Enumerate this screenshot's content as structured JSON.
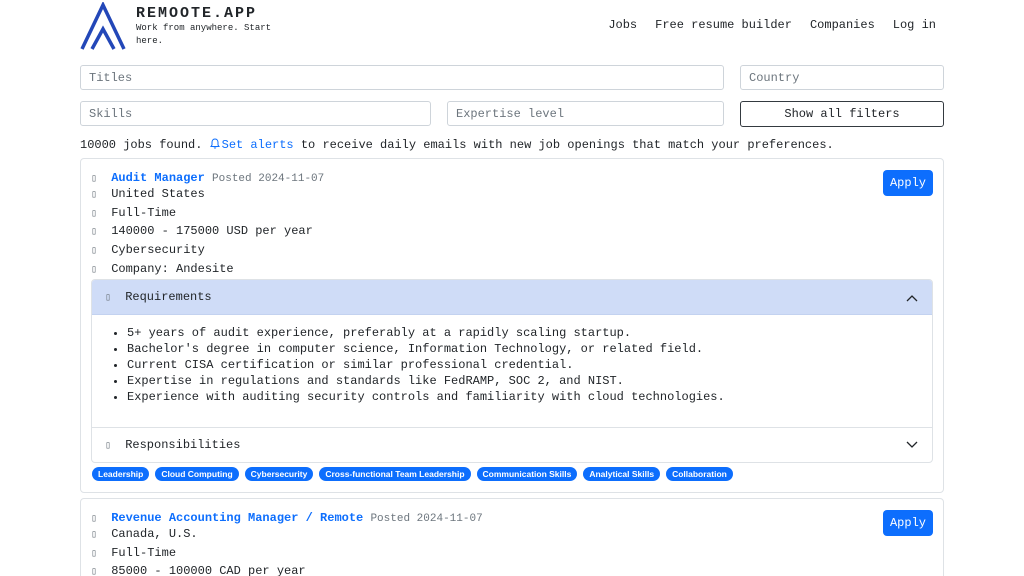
{
  "brand": {
    "name": "REMOOTE.APP",
    "tagline": "Work from anywhere. Start here."
  },
  "nav": {
    "jobs": "Jobs",
    "resume": "Free resume builder",
    "companies": "Companies",
    "login": "Log in"
  },
  "filters": {
    "titles_placeholder": "Titles",
    "country_placeholder": "Country",
    "skills_placeholder": "Skills",
    "expertise_placeholder": "Expertise level",
    "show_all": "Show all filters"
  },
  "summary": {
    "count": "10000 jobs found.",
    "alerts_link": "Set alerts",
    "rest": "to receive daily emails with new job openings that match your preferences."
  },
  "jobs": [
    {
      "title": "Audit Manager",
      "posted": "Posted 2024-11-07",
      "location": "United States",
      "type": "Full-Time",
      "salary": "140000 - 175000 USD per year",
      "category": "Cybersecurity",
      "company": "Company: Andesite",
      "apply": "Apply",
      "requirements_label": "Requirements",
      "responsibilities_label": "Responsibilities",
      "requirements": [
        "5+ years of audit experience, preferably at a rapidly scaling startup.",
        "Bachelor's degree in computer science, Information Technology, or related field.",
        "Current CISA certification or similar professional credential.",
        "Expertise in regulations and standards like FedRAMP, SOC 2, and NIST.",
        "Experience with auditing security controls and familiarity with cloud technologies."
      ],
      "tags": [
        "Leadership",
        "Cloud Computing",
        "Cybersecurity",
        "Cross-functional Team Leadership",
        "Communication Skills",
        "Analytical Skills",
        "Collaboration"
      ]
    },
    {
      "title": "Revenue Accounting Manager / Remote",
      "posted": "Posted 2024-11-07",
      "location": "Canada, U.S.",
      "type": "Full-Time",
      "salary": "85000 - 100000 CAD per year",
      "apply": "Apply"
    }
  ],
  "icons": {
    "detail_glyph": "▯"
  },
  "colors": {
    "accent": "#0d6efd",
    "accordion_open": "#cfdcf7",
    "text": "#212529"
  }
}
